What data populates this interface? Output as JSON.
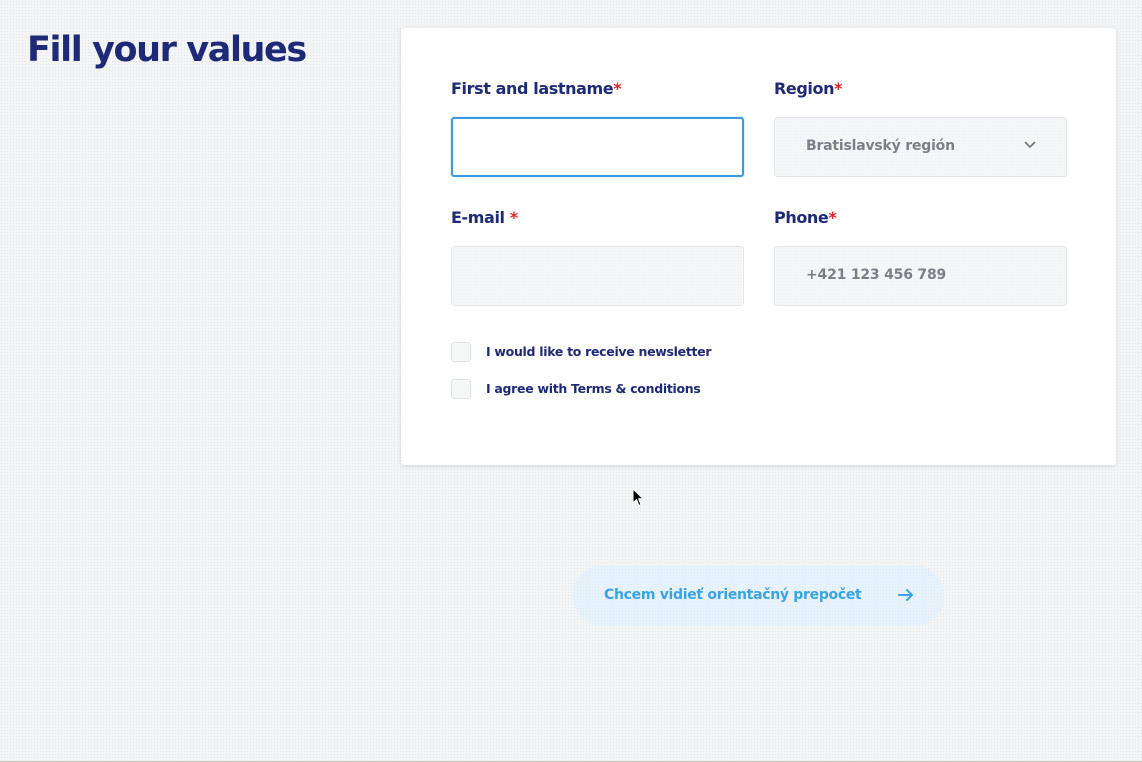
{
  "page": {
    "title": "Fill your values"
  },
  "form": {
    "name": {
      "label": "First and lastname",
      "required_mark": "*",
      "value": ""
    },
    "region": {
      "label": "Region",
      "required_mark": "*",
      "selected": "Bratislavský región",
      "icon": "chevron-down-icon"
    },
    "email": {
      "label": "E-mail ",
      "required_mark": "*",
      "value": ""
    },
    "phone": {
      "label": "Phone",
      "required_mark": "*",
      "placeholder": "+421 123 456 789"
    },
    "newsletter": {
      "label": "I would like to receive newsletter",
      "checked": false
    },
    "terms": {
      "label": "I agree with Terms & conditions",
      "checked": false
    }
  },
  "cta": {
    "label": "Chcem vidieť orientačný prepočet",
    "icon": "arrow-right-icon"
  },
  "colors": {
    "heading": "#1e2a78",
    "required": "#e0242a",
    "focus_border": "#3b9ae1",
    "cta_text": "#3aa3e8",
    "cta_background": "#e7f2fb"
  }
}
